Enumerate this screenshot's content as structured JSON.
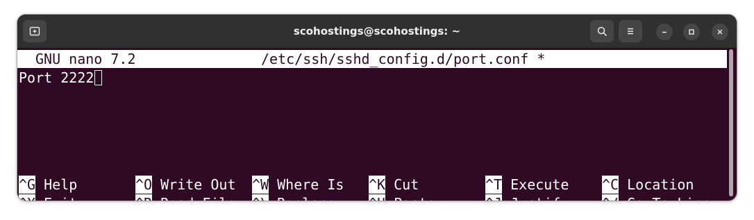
{
  "window": {
    "title": "scohostings@scohostings: ~"
  },
  "nano": {
    "header_version": "GNU nano 7.2",
    "header_file": "/etc/ssh/sshd_config.d/port.conf *",
    "content_line": "Port 2222"
  },
  "shortcuts": [
    {
      "key": "^G",
      "label": "Help"
    },
    {
      "key": "^O",
      "label": "Write Out"
    },
    {
      "key": "^W",
      "label": "Where Is"
    },
    {
      "key": "^K",
      "label": "Cut"
    },
    {
      "key": "^T",
      "label": "Execute"
    },
    {
      "key": "^C",
      "label": "Location"
    },
    {
      "key": "^X",
      "label": "Exit"
    },
    {
      "key": "^R",
      "label": "Read File"
    },
    {
      "key": "^\\",
      "label": "Replace"
    },
    {
      "key": "^U",
      "label": "Paste"
    },
    {
      "key": "^J",
      "label": "Justify"
    },
    {
      "key": "^/",
      "label": "Go To Line"
    }
  ],
  "colors": {
    "terminal_bg": "#300a24",
    "titlebar_bg": "#303030",
    "text": "#ffffff"
  },
  "icons": {
    "new_tab": "new-tab-icon",
    "search": "search-icon",
    "menu": "hamburger-menu-icon",
    "minimize": "minimize-icon",
    "maximize": "maximize-icon",
    "close": "close-icon"
  }
}
